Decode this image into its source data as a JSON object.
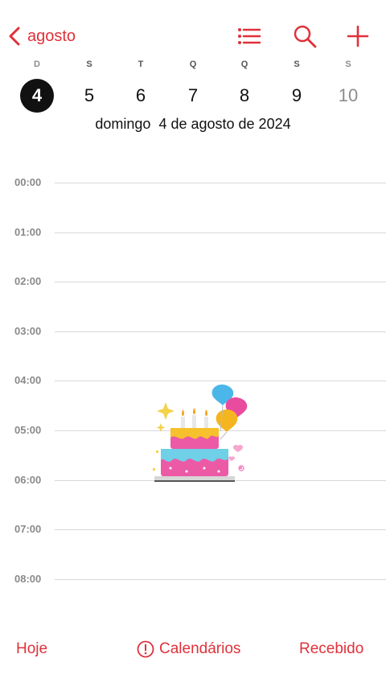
{
  "header": {
    "back_label": "agosto"
  },
  "week": {
    "weekdays": [
      "D",
      "S",
      "T",
      "Q",
      "Q",
      "S",
      "S"
    ],
    "days": [
      "4",
      "5",
      "6",
      "7",
      "8",
      "9",
      "10"
    ],
    "selected_index": 0
  },
  "selected_date": {
    "weekday": "domingo",
    "date": "4 de agosto de 2024"
  },
  "hours": [
    "00:00",
    "01:00",
    "02:00",
    "03:00",
    "04:00",
    "05:00",
    "06:00",
    "07:00",
    "08:00"
  ],
  "bottom": {
    "today": "Hoje",
    "calendars": "Calendários",
    "inbox": "Recebido"
  },
  "colors": {
    "accent": "#e0313a",
    "selected_day_bg": "#111111",
    "weekend_text": "#8c8c8c",
    "gridline": "#d8d8d8"
  },
  "icons": [
    "chevron-left-icon",
    "list-icon",
    "search-icon",
    "plus-icon",
    "alert-circle-icon",
    "birthday-cake-sticker"
  ]
}
